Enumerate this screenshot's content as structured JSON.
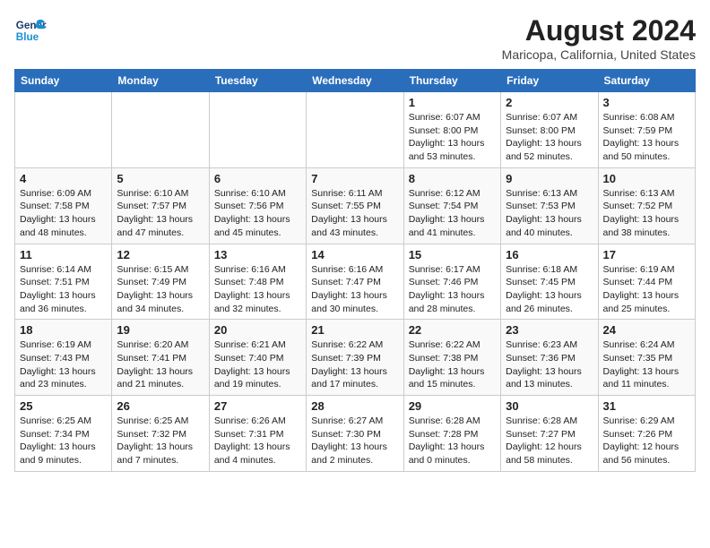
{
  "logo": {
    "line1": "General",
    "line2": "Blue"
  },
  "title": "August 2024",
  "subtitle": "Maricopa, California, United States",
  "weekdays": [
    "Sunday",
    "Monday",
    "Tuesday",
    "Wednesday",
    "Thursday",
    "Friday",
    "Saturday"
  ],
  "weeks": [
    [
      {
        "day": "",
        "info": ""
      },
      {
        "day": "",
        "info": ""
      },
      {
        "day": "",
        "info": ""
      },
      {
        "day": "",
        "info": ""
      },
      {
        "day": "1",
        "info": "Sunrise: 6:07 AM\nSunset: 8:00 PM\nDaylight: 13 hours\nand 53 minutes."
      },
      {
        "day": "2",
        "info": "Sunrise: 6:07 AM\nSunset: 8:00 PM\nDaylight: 13 hours\nand 52 minutes."
      },
      {
        "day": "3",
        "info": "Sunrise: 6:08 AM\nSunset: 7:59 PM\nDaylight: 13 hours\nand 50 minutes."
      }
    ],
    [
      {
        "day": "4",
        "info": "Sunrise: 6:09 AM\nSunset: 7:58 PM\nDaylight: 13 hours\nand 48 minutes."
      },
      {
        "day": "5",
        "info": "Sunrise: 6:10 AM\nSunset: 7:57 PM\nDaylight: 13 hours\nand 47 minutes."
      },
      {
        "day": "6",
        "info": "Sunrise: 6:10 AM\nSunset: 7:56 PM\nDaylight: 13 hours\nand 45 minutes."
      },
      {
        "day": "7",
        "info": "Sunrise: 6:11 AM\nSunset: 7:55 PM\nDaylight: 13 hours\nand 43 minutes."
      },
      {
        "day": "8",
        "info": "Sunrise: 6:12 AM\nSunset: 7:54 PM\nDaylight: 13 hours\nand 41 minutes."
      },
      {
        "day": "9",
        "info": "Sunrise: 6:13 AM\nSunset: 7:53 PM\nDaylight: 13 hours\nand 40 minutes."
      },
      {
        "day": "10",
        "info": "Sunrise: 6:13 AM\nSunset: 7:52 PM\nDaylight: 13 hours\nand 38 minutes."
      }
    ],
    [
      {
        "day": "11",
        "info": "Sunrise: 6:14 AM\nSunset: 7:51 PM\nDaylight: 13 hours\nand 36 minutes."
      },
      {
        "day": "12",
        "info": "Sunrise: 6:15 AM\nSunset: 7:49 PM\nDaylight: 13 hours\nand 34 minutes."
      },
      {
        "day": "13",
        "info": "Sunrise: 6:16 AM\nSunset: 7:48 PM\nDaylight: 13 hours\nand 32 minutes."
      },
      {
        "day": "14",
        "info": "Sunrise: 6:16 AM\nSunset: 7:47 PM\nDaylight: 13 hours\nand 30 minutes."
      },
      {
        "day": "15",
        "info": "Sunrise: 6:17 AM\nSunset: 7:46 PM\nDaylight: 13 hours\nand 28 minutes."
      },
      {
        "day": "16",
        "info": "Sunrise: 6:18 AM\nSunset: 7:45 PM\nDaylight: 13 hours\nand 26 minutes."
      },
      {
        "day": "17",
        "info": "Sunrise: 6:19 AM\nSunset: 7:44 PM\nDaylight: 13 hours\nand 25 minutes."
      }
    ],
    [
      {
        "day": "18",
        "info": "Sunrise: 6:19 AM\nSunset: 7:43 PM\nDaylight: 13 hours\nand 23 minutes."
      },
      {
        "day": "19",
        "info": "Sunrise: 6:20 AM\nSunset: 7:41 PM\nDaylight: 13 hours\nand 21 minutes."
      },
      {
        "day": "20",
        "info": "Sunrise: 6:21 AM\nSunset: 7:40 PM\nDaylight: 13 hours\nand 19 minutes."
      },
      {
        "day": "21",
        "info": "Sunrise: 6:22 AM\nSunset: 7:39 PM\nDaylight: 13 hours\nand 17 minutes."
      },
      {
        "day": "22",
        "info": "Sunrise: 6:22 AM\nSunset: 7:38 PM\nDaylight: 13 hours\nand 15 minutes."
      },
      {
        "day": "23",
        "info": "Sunrise: 6:23 AM\nSunset: 7:36 PM\nDaylight: 13 hours\nand 13 minutes."
      },
      {
        "day": "24",
        "info": "Sunrise: 6:24 AM\nSunset: 7:35 PM\nDaylight: 13 hours\nand 11 minutes."
      }
    ],
    [
      {
        "day": "25",
        "info": "Sunrise: 6:25 AM\nSunset: 7:34 PM\nDaylight: 13 hours\nand 9 minutes."
      },
      {
        "day": "26",
        "info": "Sunrise: 6:25 AM\nSunset: 7:32 PM\nDaylight: 13 hours\nand 7 minutes."
      },
      {
        "day": "27",
        "info": "Sunrise: 6:26 AM\nSunset: 7:31 PM\nDaylight: 13 hours\nand 4 minutes."
      },
      {
        "day": "28",
        "info": "Sunrise: 6:27 AM\nSunset: 7:30 PM\nDaylight: 13 hours\nand 2 minutes."
      },
      {
        "day": "29",
        "info": "Sunrise: 6:28 AM\nSunset: 7:28 PM\nDaylight: 13 hours\nand 0 minutes."
      },
      {
        "day": "30",
        "info": "Sunrise: 6:28 AM\nSunset: 7:27 PM\nDaylight: 12 hours\nand 58 minutes."
      },
      {
        "day": "31",
        "info": "Sunrise: 6:29 AM\nSunset: 7:26 PM\nDaylight: 12 hours\nand 56 minutes."
      }
    ]
  ]
}
